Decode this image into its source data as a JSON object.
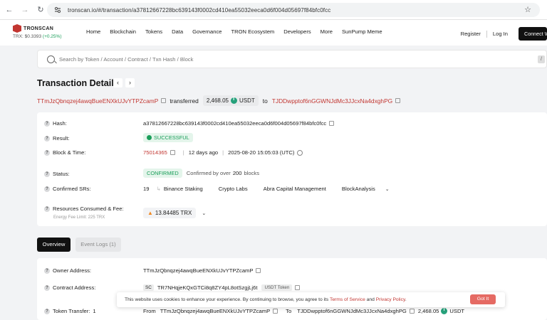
{
  "browser": {
    "url": "tronscan.io/#/transaction/a37812667228bc639143f0002cd410ea55032eeca0d6f004d05697f84bfc0fcc"
  },
  "header": {
    "logo": "TRONSCAN",
    "trx_price_label": "TRX: $0.3393",
    "trx_change": "(+0.25%)",
    "nav": [
      "Home",
      "Blockchain",
      "Tokens",
      "Data",
      "Governance",
      "TRON Ecosystem",
      "Developers",
      "More",
      "SunPump Meme"
    ],
    "register": "Register",
    "login": "Log In",
    "connect": "Connect W"
  },
  "search": {
    "placeholder": "Search by Token / Account / Contract / Txn Hash / Block",
    "shortcut": "/"
  },
  "title": "Transaction Details",
  "summary": {
    "from": "TTmJzQbnqzej4awqBueENXkUJvYTPZcamP",
    "verb": "transferred",
    "amount": "2,468.05",
    "token": "USDT",
    "to_word": "to",
    "to": "TJDDwpptof6nGGWNJdMc3JJcxNa4dxghPG"
  },
  "details": {
    "hash_label": "Hash:",
    "hash": "a37812667228bc639143f0002cd410ea55032eeca0d6f004d05697f84bfc0fcc",
    "result_label": "Result:",
    "result": "SUCCESSFUL",
    "block_label": "Block & Time:",
    "block": "75014365",
    "age": "12 days ago",
    "time": "2025-08-20 15:05:03 (UTC)",
    "status_label": "Status:",
    "status": "CONFIRMED",
    "confirmed_by_prefix": "Confirmed by over",
    "confirmed_count": "200",
    "confirmed_suffix": "blocks",
    "srs_label": "Confirmed SRs:",
    "srs_count": "19",
    "srs": [
      "Binance Staking",
      "Crypto Labs",
      "Abra Capital Management",
      "BlockAnalysis"
    ],
    "resources_label": "Resources Consumed & Fee:",
    "energy_limit": "Energy Fee Limit: 225 TRX",
    "fee": "13.84485 TRX"
  },
  "tabs": {
    "overview": "Overview",
    "event_logs": "Event Logs (1)"
  },
  "overview": {
    "owner_label": "Owner Address:",
    "owner": "TTmJzQbnqzej4awqBueENXkUJvYTPZcamP",
    "contract_label": "Contract Address:",
    "contract_badge": "SC",
    "contract": "TR7NHqjeKQxGTCi8q8ZY4pL8otSzgjLj6t",
    "contract_tag": "USDT Token",
    "transfer_label": "Token Transfer:",
    "transfer_count": "1",
    "from_word": "From",
    "from": "TTmJzQbnqzej4awqBueENXkUJvYTPZcamP",
    "to_word": "To",
    "to": "TJDDwpptof6nGGWNJdMc3JJcxNa4dxghPG",
    "amount": "2,468.05",
    "token": "USDT"
  },
  "cookie": {
    "text": "This website uses cookies to enhance your experience. By continuing to browse, you agree to its",
    "terms": "Terms of Service",
    "and": "and",
    "privacy": "Privacy Policy",
    "period": ".",
    "button": "Got It"
  }
}
